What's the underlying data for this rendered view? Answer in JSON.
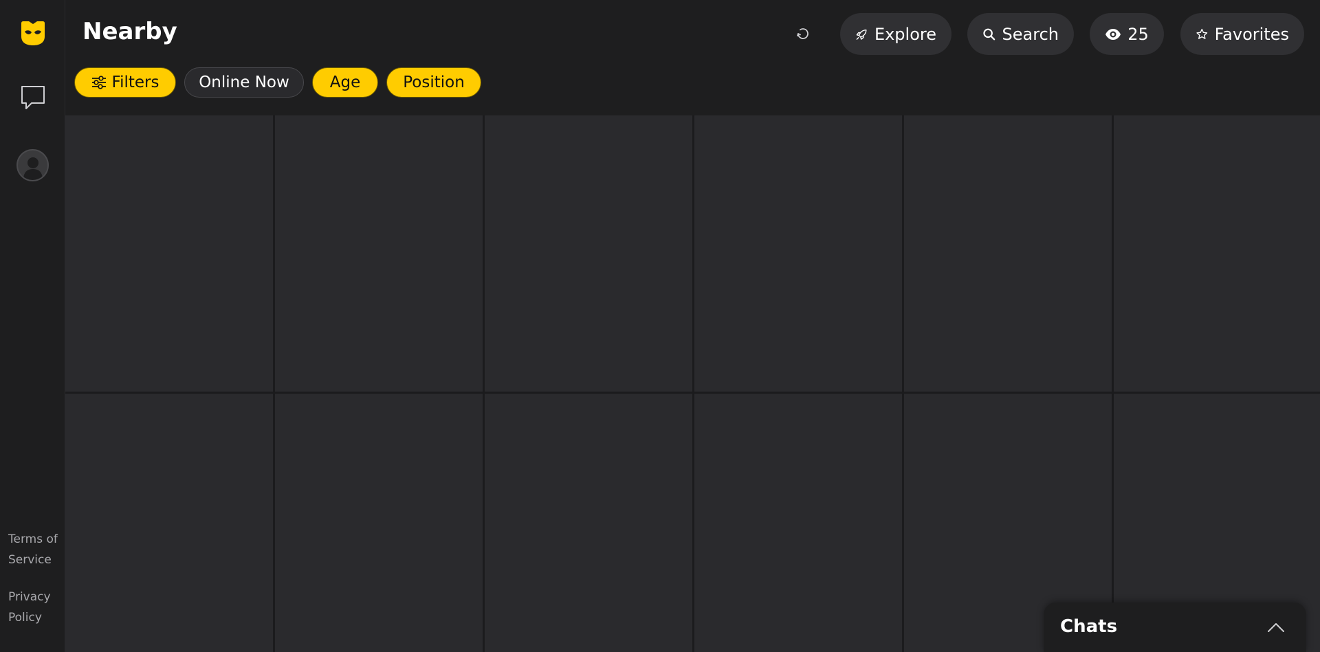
{
  "header": {
    "title": "Nearby",
    "explore_label": "Explore",
    "search_label": "Search",
    "views_count": "25",
    "favorites_label": "Favorites"
  },
  "filters": {
    "filters_label": "Filters",
    "online_now_label": "Online Now",
    "age_label": "Age",
    "position_label": "Position"
  },
  "sidebar": {
    "terms_label": "Terms of Service",
    "privacy_label": "Privacy Policy"
  },
  "grid": {
    "tile_count": 12
  },
  "chats": {
    "title": "Chats"
  },
  "colors": {
    "accent": "#ffcc00",
    "background": "#1e1e1f",
    "tile": "#2a2a2d",
    "pill": "#303033"
  },
  "icons": {
    "logo": "mask-logo-icon",
    "chat": "chat-bubble-icon",
    "profile": "avatar-icon",
    "refresh": "refresh-icon",
    "explore": "rocket-icon",
    "search": "search-icon",
    "views": "eye-icon",
    "favorites": "star-icon",
    "filters": "sliders-icon",
    "chats_toggle": "chevron-up-icon"
  }
}
